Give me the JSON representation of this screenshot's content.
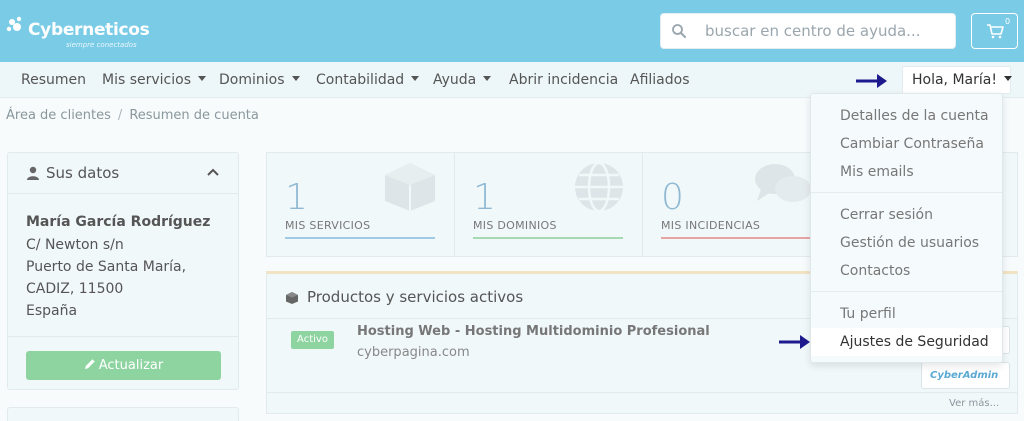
{
  "header": {
    "logo_name": "Cyberneticos",
    "logo_tagline": "siempre conectados",
    "search_placeholder": "buscar en centro de ayuda...",
    "cart_count": "0"
  },
  "nav": {
    "items": [
      {
        "label": "Resumen",
        "dropdown": false
      },
      {
        "label": "Mis servicios",
        "dropdown": true
      },
      {
        "label": "Dominios",
        "dropdown": true
      },
      {
        "label": "Contabilidad",
        "dropdown": true
      },
      {
        "label": "Ayuda",
        "dropdown": true
      },
      {
        "label": "Abrir incidencia",
        "dropdown": false
      },
      {
        "label": "Afiliados",
        "dropdown": false
      }
    ],
    "greeting": "Hola, María!"
  },
  "breadcrumb": {
    "root": "Área de clientes",
    "separator": "/",
    "current": "Resumen de cuenta"
  },
  "user_panel": {
    "title": "Sus datos",
    "name": "María García Rodríguez",
    "address": [
      "C/ Newton s/n",
      "Puerto de Santa María,",
      "CADIZ, 11500",
      "España"
    ],
    "update_label": "Actualizar"
  },
  "stats": [
    {
      "value": "1",
      "label": "MIS SERVICIOS",
      "color": "#9fc9e4",
      "icon": "cube-icon"
    },
    {
      "value": "1",
      "label": "MIS DOMINIOS",
      "color": "#a6d8b1",
      "icon": "globe-icon"
    },
    {
      "value": "0",
      "label": "MIS INCIDENCIAS",
      "color": "#e8a3a3",
      "icon": "comments-icon"
    }
  ],
  "products": {
    "title": "Productos y servicios activos",
    "items": [
      {
        "status": "Activo",
        "name": "Hosting Web - Hosting Multidominio Profesional",
        "domain": "cyberpagina.com"
      }
    ],
    "cyberadmin_label": "CyberAdmin",
    "see_more": "Ver más..."
  },
  "dropdown": {
    "groups": [
      [
        "Detalles de la cuenta",
        "Cambiar Contraseña",
        "Mis emails"
      ],
      [
        "Cerrar sesión",
        "Gestión de usuarios",
        "Contactos"
      ],
      [
        "Tu perfil",
        "Ajustes de Seguridad"
      ]
    ],
    "highlighted": "Ajustes de Seguridad"
  },
  "colors": {
    "header_bg": "#7acbe6",
    "success_green": "#8ed4a0",
    "arrow_blue": "#1c1a8c"
  }
}
